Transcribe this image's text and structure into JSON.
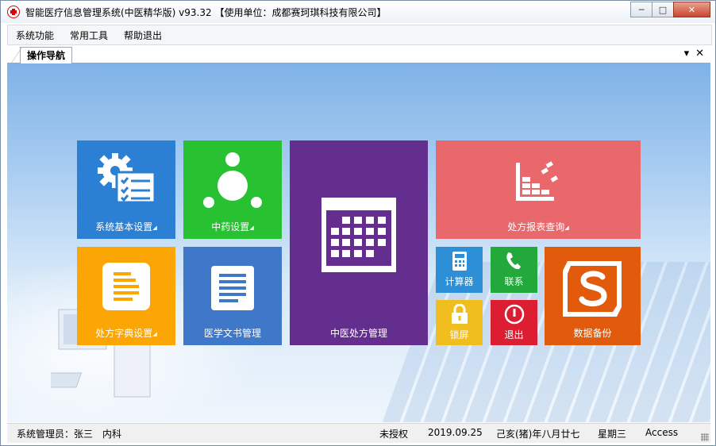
{
  "window": {
    "title": "智能医疗信息管理系统(中医精华版) v93.32   【使用单位：成都赛珂琪科技有限公司】",
    "controls": {
      "minimize": "─",
      "maximize": "□",
      "close": "✕"
    }
  },
  "menu": {
    "items": [
      "系统功能",
      "常用工具",
      "帮助退出"
    ]
  },
  "tabs": {
    "active": "操作导航",
    "dropdown": "▾",
    "close": "✕"
  },
  "tiles": {
    "basic_settings": {
      "label": "系统基本设置",
      "arrow": "◢",
      "color": "#2b80d4",
      "icon": "gear-form-icon"
    },
    "herb_settings": {
      "label": "中药设置",
      "arrow": "◢",
      "color": "#27c132",
      "icon": "network-icon"
    },
    "tcm_prescription": {
      "label": "中医处方管理",
      "color": "#642e8e",
      "icon": "calendar-icon"
    },
    "prescription_report": {
      "label": "处方报表查询",
      "arrow": "◢",
      "color": "#e8686c",
      "icon": "chart-icon"
    },
    "prescription_dictionary": {
      "label": "处方字典设置",
      "arrow": "◢",
      "color": "#fba605",
      "icon": "document-icon"
    },
    "medical_docs": {
      "label": "医学文书管理",
      "color": "#3f78c8",
      "icon": "document-lines-icon"
    },
    "calculator": {
      "label": "计算器",
      "color": "#2d8fd5",
      "icon": "calculator-icon"
    },
    "contact": {
      "label": "联系",
      "color": "#23a83b",
      "icon": "phone-icon"
    },
    "lock_screen": {
      "label": "锁屏",
      "color": "#f1be1f",
      "icon": "lock-icon"
    },
    "exit": {
      "label": "退出",
      "color": "#dc1e33",
      "icon": "power-icon"
    },
    "data_backup": {
      "label": "数据备份",
      "color": "#e25a0b",
      "icon": "s-icon"
    }
  },
  "status": {
    "user": "系统管理员：张三",
    "dept": "内科",
    "license": "未授权",
    "date": "2019.09.25",
    "lunar": "己亥(猪)年八月廿七",
    "weekday": "星期三",
    "db": "Access"
  }
}
